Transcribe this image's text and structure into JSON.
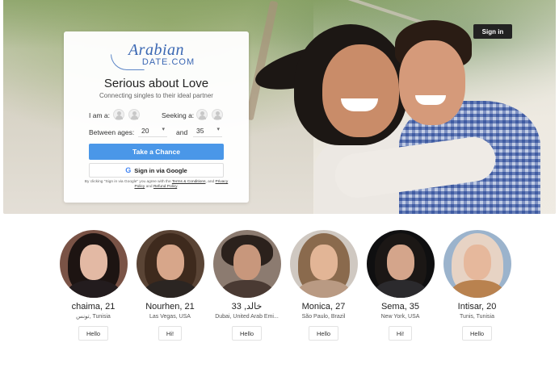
{
  "header": {
    "signin_label": "Sign in"
  },
  "logo": {
    "top": "Arabian",
    "bottom": "DATE.COM"
  },
  "card": {
    "headline": "Serious about Love",
    "subheadline": "Connecting singles to their ideal partner",
    "i_am_label": "I am a:",
    "seeking_label": "Seeking a:",
    "between_ages_label": "Between ages:",
    "and_label": "and",
    "age_min": "20",
    "age_max": "35",
    "primary_button": "Take a Chance",
    "google_button": "Sign in via Google",
    "legal_prefix": "By clicking \"Sign in via Google\" you agree with the",
    "terms_link": "Terms & Conditions",
    "legal_mid": ", and",
    "privacy_link": "Privacy Policy",
    "legal_and": "and",
    "refund_link": "Refund Policy"
  },
  "profiles": [
    {
      "name": "chaima, 21",
      "location": "تونس, Tunisia",
      "button": "Hello"
    },
    {
      "name": "Nourhen, 21",
      "location": "Las Vegas, USA",
      "button": "Hi!"
    },
    {
      "name": "خالد, 33",
      "location": "Dubai, United Arab Emi...",
      "button": "Hello"
    },
    {
      "name": "Monica, 27",
      "location": "São Paulo, Brazil",
      "button": "Hello"
    },
    {
      "name": "Sema, 35",
      "location": "New York, USA",
      "button": "Hi!"
    },
    {
      "name": "Intisar, 20",
      "location": "Tunis, Tunisia",
      "button": "Hello"
    }
  ],
  "colors": {
    "primary": "#4a97e8",
    "logo": "#3a67b3",
    "signin_bg": "#222222"
  },
  "icons": {
    "gender_male": "male-avatar-icon",
    "gender_female": "female-avatar-icon",
    "caret": "chevron-down-icon",
    "google": "google-icon"
  }
}
